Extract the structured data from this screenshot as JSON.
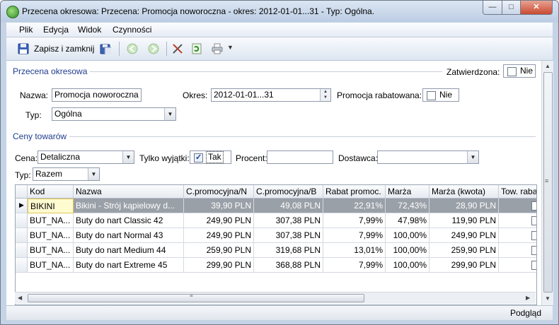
{
  "window": {
    "title": "Przecena okresowa: Przecena: Promocja noworoczna - okres: 2012-01-01...31 - Typ: Ogólna.",
    "min_glyph": "—",
    "max_glyph": "□",
    "close_glyph": "✕"
  },
  "menu": [
    "Plik",
    "Edycja",
    "Widok",
    "Czynności"
  ],
  "toolbar": {
    "save_close_label": "Zapisz i zamknij"
  },
  "header_group": {
    "title": "Przecena okresowa",
    "approved_label": "Zatwierdzona:",
    "approved_value": "Nie",
    "name_label": "Nazwa:",
    "name_value": "Promocja noworoczna",
    "period_label": "Okres:",
    "period_value": "2012-01-01...31",
    "promo_label": "Promocja rabatowana:",
    "promo_value": "Nie",
    "type_label": "Typ:",
    "type_value": "Ogólna"
  },
  "prices_group": {
    "title": "Ceny towarów",
    "price_label": "Cena:",
    "price_value": "Detaliczna",
    "only_exceptions_label": "Tylko wyjątki:",
    "only_exceptions_value": "Tak",
    "percent_label": "Procent:",
    "percent_value": "",
    "supplier_label": "Dostawca:",
    "supplier_value": "",
    "type_label": "Typ:",
    "type_value": "Razem"
  },
  "grid": {
    "columns": [
      "Kod",
      "Nazwa",
      "C.promocyjna/N",
      "C.promocyjna/B",
      "Rabat promoc.",
      "Marża",
      "Marża (kwota)",
      "Tow. rabat"
    ],
    "rows": [
      [
        "BIKINI",
        "Bikini - Strój kąpielowy d...",
        "39,90 PLN",
        "49,08 PLN",
        "22,91%",
        "72,43%",
        "28,90 PLN"
      ],
      [
        "BUT_NA...",
        "Buty do nart Classic 42",
        "249,90 PLN",
        "307,38 PLN",
        "7,99%",
        "47,98%",
        "119,90 PLN"
      ],
      [
        "BUT_NA...",
        "Buty do nart Normal 43",
        "249,90 PLN",
        "307,38 PLN",
        "7,99%",
        "100,00%",
        "249,90 PLN"
      ],
      [
        "BUT_NA...",
        "Buty do nart Medium 44",
        "259,90 PLN",
        "319,68 PLN",
        "13,01%",
        "100,00%",
        "259,90 PLN"
      ],
      [
        "BUT_NA...",
        "Buty do nart Extreme 45",
        "299,90 PLN",
        "368,88 PLN",
        "7,99%",
        "100,00%",
        "299,90 PLN"
      ]
    ]
  },
  "status": {
    "mode": "Podgląd"
  },
  "colors": {
    "accent": "#1f3c8c",
    "selection": "#9aa0a8"
  }
}
